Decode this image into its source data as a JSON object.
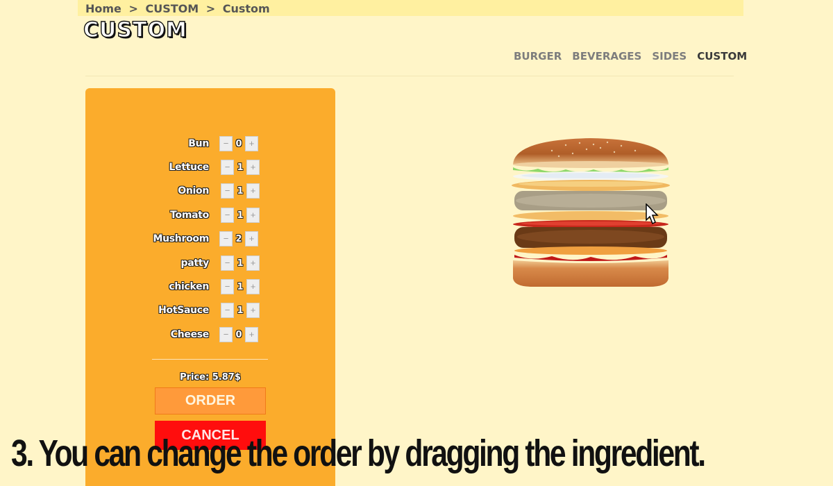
{
  "breadcrumb": {
    "home": "Home",
    "section": "CUSTOM",
    "page": "Custom"
  },
  "page_title": "CUSTOM",
  "nav": {
    "items": [
      "BURGER",
      "BEVERAGES",
      "SIDES",
      "CUSTOM"
    ],
    "active": "CUSTOM"
  },
  "ingredients": [
    {
      "label": "Bun",
      "qty": "0"
    },
    {
      "label": "Lettuce",
      "qty": "1"
    },
    {
      "label": "Onion",
      "qty": "1"
    },
    {
      "label": "Tomato",
      "qty": "1"
    },
    {
      "label": "Mushroom",
      "qty": "2"
    },
    {
      "label": "patty",
      "qty": "1"
    },
    {
      "label": "chicken",
      "qty": "1"
    },
    {
      "label": "HotSauce",
      "qty": "1"
    },
    {
      "label": "Cheese",
      "qty": "0"
    }
  ],
  "controls": {
    "minus": "−",
    "plus": "+"
  },
  "price_text": "Price: 5.87$",
  "order_label": "ORDER",
  "cancel_label": "CANCEL",
  "caption": "3. You can change the order by dragging the ingredient.",
  "colors": {
    "panel": "#fbac2c",
    "order": "#ff9a3a",
    "cancel": "#ff0d0d",
    "background": "#fff5c8"
  }
}
